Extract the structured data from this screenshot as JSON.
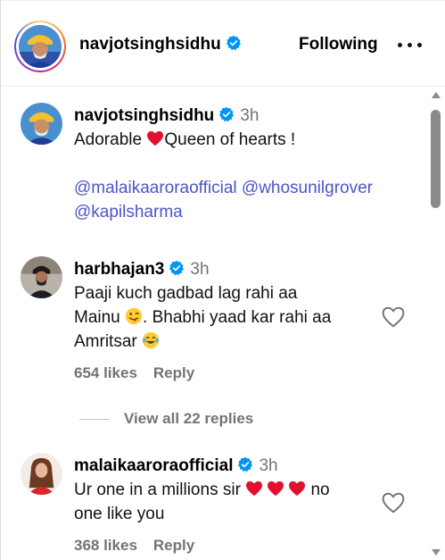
{
  "header": {
    "username": "navjotsinghsidhu",
    "follow_label": "Following",
    "more_icon": "more-horizontal-icon"
  },
  "comments": [
    {
      "username": "navjotsinghsidhu",
      "time": "3h",
      "text_before": "Adorable ",
      "text_after": "Queen of hearts !",
      "mentions_line1": "@malaikaarorаofficial @whosunilgrover",
      "mentions_line2": "@kapilsharma",
      "verified": true
    },
    {
      "username": "harbhajan3",
      "time": "3h",
      "line1": "Paaji kuch gadbad lag rahi aa",
      "line2_a": "Mainu ",
      "line2_b": ". Bhabhi yaad kar rahi aa",
      "line3": "Amritsar ",
      "likes": "654 likes",
      "reply": "Reply",
      "verified": true
    },
    {
      "username": "malaikaaroraofficial",
      "time": "3h",
      "line1_a": "Ur one in a millions sir ",
      "line1_b": " no",
      "line2": "one like you",
      "likes": "368 likes",
      "reply": "Reply",
      "verified": true
    }
  ],
  "view_replies": "View all 22 replies",
  "colors": {
    "verified_blue": "#0095f6",
    "mention": "#4b54c9",
    "secondary_text": "#737373",
    "heart_red": "#e0102c"
  }
}
